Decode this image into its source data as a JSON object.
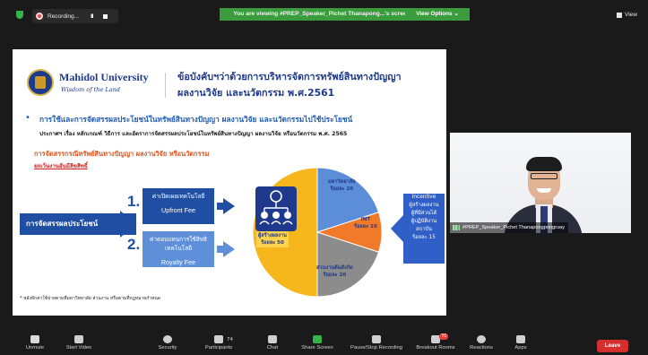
{
  "topbar": {
    "recording_label": "Recording...",
    "pause_glyph": "II",
    "banner_text": "You are viewing #PREP_Speaker_Pichet Thanapong...'s screen",
    "view_options_label": "View Options ⌄",
    "view_button_label": "View"
  },
  "slide": {
    "university_name": "Mahidol University",
    "university_tagline": "Wisdom of the Land",
    "title_line1": "ข้อบังคับฯว่าด้วยการบริหารจัดการทรัพย์สินทางปัญญา",
    "title_line2": "ผลงานวิจัย และนวัตกรรม พ.ศ.2561",
    "bullet": "การใช้และการจัดสรรผลประโยชน์ในทรัพย์สินทางปัญญา ผลงานวิจัย และนวัตกรรมไปใช้ประโยชน์",
    "reference": "ประกาศฯ เรื่อง หลักเกณฑ์ วิธีการ และอัตราการจัดสรรผลประโยชน์ในทรัพย์สินทางปัญญา ผลงานวิจัย หรือนวัตกรรม พ.ศ. 2565",
    "section_title": "การจัดสรรกรณีทรัพย์สินทางปัญญา ผลงานวิจัย หรือนวัตกรรม",
    "section_sub": "ยกเว้นงานอันมีลิขสิทธิ์",
    "commerce_label": "การจัดสรรผลประโยชน์",
    "options": [
      {
        "number": "1.",
        "thai": "ค่าเปิดเผยเทคโนโลยี",
        "english": "Upfront Fee"
      },
      {
        "number": "2.",
        "thai": "ค่าตอบแทนการใช้สิทธิเทคโนโลยี",
        "english": "Royalty Fee"
      }
    ],
    "pie": {
      "slices": [
        {
          "label": "ผู้สร้างผลงาน",
          "value_label": "ร้อยละ 50",
          "percent": 50,
          "color": "#f5b71c"
        },
        {
          "label": "มหาวิทยาลัย",
          "value_label": "ร้อยละ 20",
          "percent": 20,
          "color": "#5b8ed6"
        },
        {
          "label": "INT",
          "value_label": "ร้อยละ 10",
          "percent": 10,
          "color": "#f07a2a"
        },
        {
          "label": "ส่วนงานต้นสังกัด",
          "value_label": "ร้อยละ 20",
          "percent": 20,
          "color": "#8c8c8c"
        }
      ]
    },
    "incentive": {
      "title": "Incentive",
      "line1": "ผู้สร้างผลงาน",
      "line2": "ผู้ที่มีส่วนได้",
      "line3": "ผู้ปฏิบัติงาน",
      "line4": "สถาบัน",
      "value": "ร้อยละ 15"
    },
    "footnote": "* หลังหักค่าใช้จ่ายตามที่มหาวิทยาลัย ส่วนงาน หรือตามที่กฎหมายกำหนด"
  },
  "speaker": {
    "name_label": "#PREP_Speaker_Pichet Thanapongpongruay"
  },
  "toolbar": {
    "items": [
      {
        "label": "Unmute",
        "icon": "microphone-muted-icon"
      },
      {
        "label": "Start Video",
        "icon": "video-off-icon"
      },
      {
        "label": "Security",
        "icon": "shield-icon"
      },
      {
        "label": "Participants",
        "icon": "participants-icon",
        "count": "74"
      },
      {
        "label": "Chat",
        "icon": "chat-icon"
      },
      {
        "label": "Share Screen",
        "icon": "share-screen-icon"
      },
      {
        "label": "Pause/Stop Recording",
        "icon": "recording-icon"
      },
      {
        "label": "Breakout Rooms",
        "icon": "breakout-rooms-icon",
        "badge": "70"
      },
      {
        "label": "Reactions",
        "icon": "reactions-icon"
      },
      {
        "label": "Apps",
        "icon": "apps-icon"
      }
    ],
    "leave_label": "Leave"
  },
  "colors": {
    "banner_green": "#3a9c3d",
    "brand_blue": "#1f4ea3",
    "leave_red": "#d62d2d"
  }
}
